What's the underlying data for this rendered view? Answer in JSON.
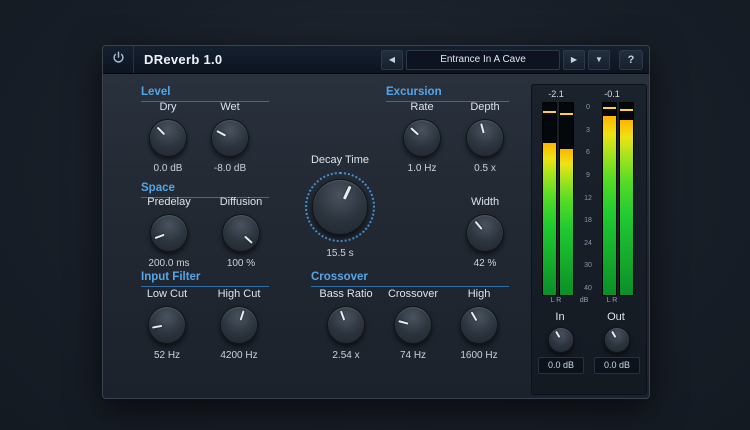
{
  "colors": {
    "accent_blue": "#55a6e8",
    "meter_green": "#1fca30",
    "meter_yellow": "#ffe600",
    "panel_dark": "#1c222b"
  },
  "window": {
    "title": "DReverb 1.0",
    "preset": {
      "name": "Entrance In A Cave",
      "prev_icon": "◀",
      "next_icon": "▶",
      "dropdown_icon": "▼",
      "help_label": "?"
    }
  },
  "sections": {
    "level": {
      "title": "Level",
      "knobs": [
        {
          "label": "Dry",
          "value": "0.0 dB"
        },
        {
          "label": "Wet",
          "value": "-8.0 dB"
        }
      ]
    },
    "excursion": {
      "title": "Excursion",
      "knobs": [
        {
          "label": "Rate",
          "value": "1.0 Hz"
        },
        {
          "label": "Depth",
          "value": "0.5 x"
        }
      ]
    },
    "decay": {
      "label": "Decay Time",
      "value": "15.5 s"
    },
    "space": {
      "title": "Space",
      "knobs": [
        {
          "label": "Predelay",
          "value": "200.0 ms"
        },
        {
          "label": "Diffusion",
          "value": "100 %"
        }
      ]
    },
    "width": {
      "label": "Width",
      "value": "42 %"
    },
    "input_filter": {
      "title": "Input Filter",
      "knobs": [
        {
          "label": "Low Cut",
          "value": "52 Hz"
        },
        {
          "label": "High Cut",
          "value": "4200 Hz"
        }
      ]
    },
    "crossover": {
      "title": "Crossover",
      "knobs": [
        {
          "label": "Bass Ratio",
          "value": "2.54 x"
        },
        {
          "label": "Crossover",
          "value": "74 Hz"
        },
        {
          "label": "High",
          "value": "1600 Hz"
        }
      ]
    }
  },
  "meters": {
    "in_peak": "-2.1",
    "out_peak": "-0.1",
    "scale": [
      "0",
      "3",
      "6",
      "9",
      "12",
      "18",
      "24",
      "30",
      "40"
    ],
    "lr": "L R",
    "db": "dB",
    "io": {
      "in_label": "In",
      "in_value": "0.0 dB",
      "out_label": "Out",
      "out_value": "0.0 dB"
    }
  }
}
